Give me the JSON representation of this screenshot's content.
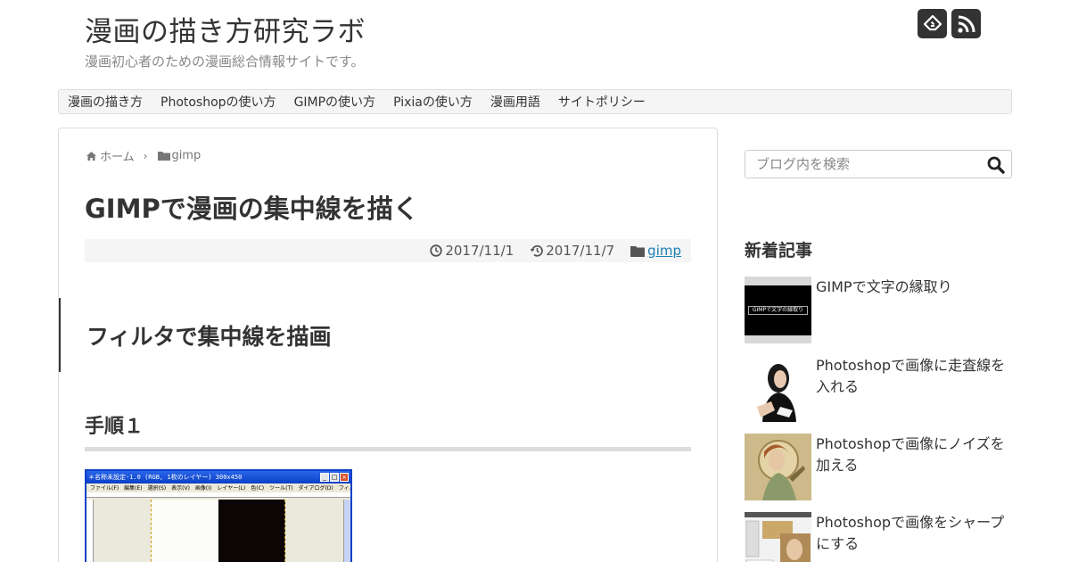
{
  "header": {
    "site_title": "漫画の描き方研究ラボ",
    "site_description": "漫画初心者のための漫画総合情報サイトです。",
    "icons": [
      "feedly-icon",
      "rss-icon"
    ]
  },
  "nav": {
    "items": [
      {
        "label": "漫画の描き方"
      },
      {
        "label": "Photoshopの使い方"
      },
      {
        "label": "GIMPの使い方"
      },
      {
        "label": "Pixiaの使い方"
      },
      {
        "label": "漫画用語"
      },
      {
        "label": "サイトポリシー"
      }
    ]
  },
  "article": {
    "breadcrumb": {
      "home": "ホーム",
      "category": "gimp"
    },
    "title": "GIMPで漫画の集中線を描く",
    "meta": {
      "published": "2017/11/1",
      "updated": "2017/11/7",
      "category": "gimp"
    },
    "h2": "フィルタで集中線を描画",
    "h3": "手順１",
    "screenshot": {
      "window_title": "＊名称未設定-1.0 (RGB, 1枚のレイヤー) 300x450",
      "menu": [
        "ファイル(F)",
        "編集(E)",
        "選択(S)",
        "表示(V)",
        "画像(I)",
        "レイヤー(L)",
        "色(C)",
        "ツール(T)",
        "ダイアログ(D)",
        "フィルタ(R)"
      ]
    }
  },
  "sidebar": {
    "search": {
      "placeholder": "ブログ内を検索"
    },
    "new_posts_title": "新着記事",
    "new_posts": [
      {
        "title": "GIMPで文字の縁取り",
        "thumb_text": "GIMPで文字の縁取り"
      },
      {
        "title": "Photoshopで画像に走査線を入れる"
      },
      {
        "title": "Photoshopで画像にノイズを加える"
      },
      {
        "title": "Photoshopで画像をシャープにする"
      }
    ]
  },
  "colors": {
    "text": "#333333",
    "muted": "#888888",
    "link": "#1a7fb5",
    "nav_bg": "#f5f5f5",
    "meta_bg": "#f5f5f5",
    "border": "#dddddd"
  }
}
